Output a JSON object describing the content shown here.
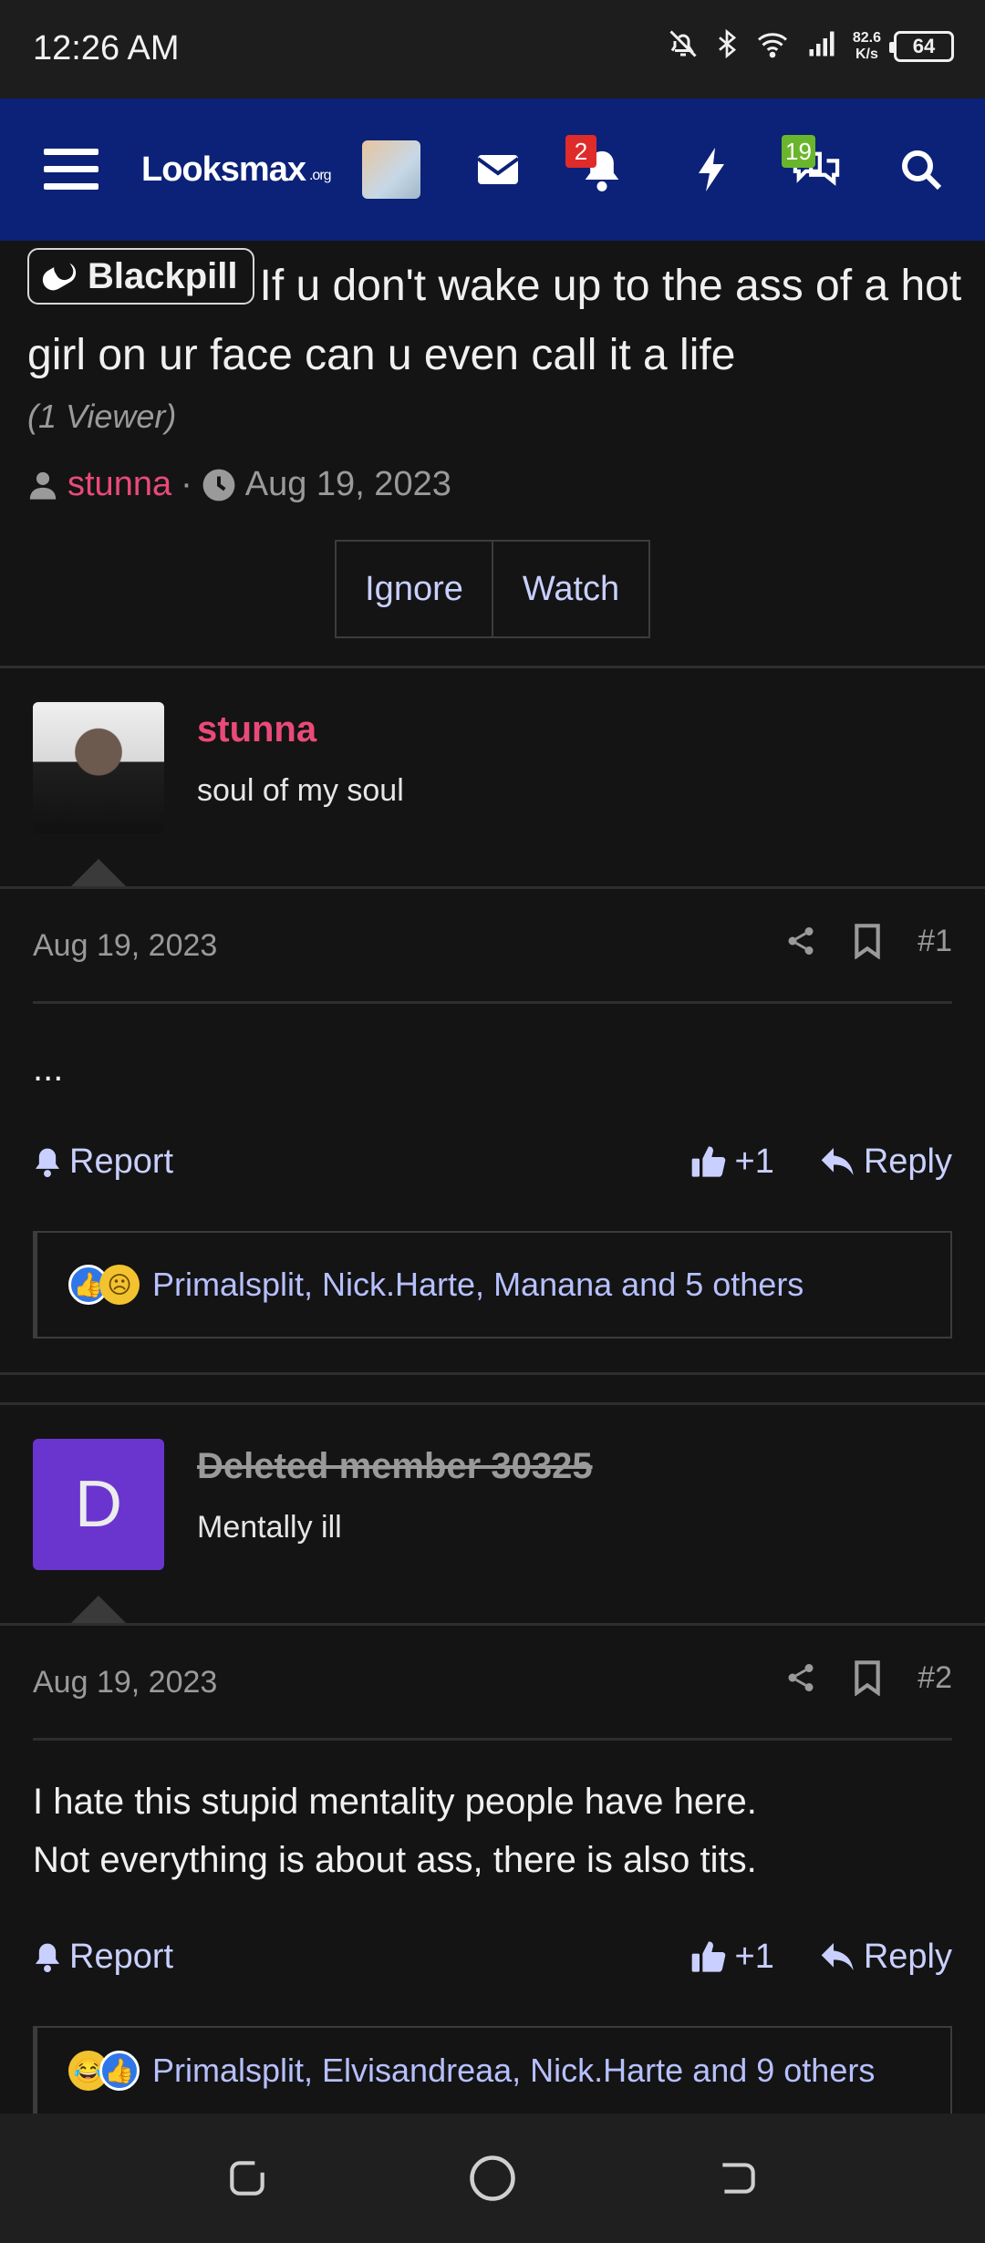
{
  "status_bar": {
    "time": "12:26 AM",
    "speed_value": "82.6",
    "speed_unit": "K/s",
    "battery": "64"
  },
  "nav": {
    "logo_main": "Looksmax",
    "logo_suffix": ".org",
    "alerts_badge": "2",
    "conversations_badge": "19"
  },
  "thread": {
    "prefix": "Blackpill",
    "title": "If u don't wake up to the ass of a hot girl on ur face can u even call it a life",
    "viewers": "(1 Viewer)",
    "author": "stunna",
    "separator": "·",
    "date": "Aug 19, 2023",
    "ignore_label": "Ignore",
    "watch_label": "Watch"
  },
  "posts": [
    {
      "username": "stunna",
      "user_title": "soul of my soul",
      "date": "Aug 19, 2023",
      "number": "#1",
      "body": "...",
      "report_label": "Report",
      "like_label": "+1",
      "reply_label": "Reply",
      "reactions": "Primalsplit, Nick.Harte, Manana and 5 others"
    },
    {
      "username": "Deleted member 30325",
      "avatar_letter": "D",
      "user_title": "Mentally ill",
      "date": "Aug 19, 2023",
      "number": "#2",
      "body_line1": "I hate this stupid mentality people have here.",
      "body_line2": "Not everything is about ass, there is also tits.",
      "report_label": "Report",
      "like_label": "+1",
      "reply_label": "Reply",
      "reactions": "Primalsplit, Elvisandreaa, Nick.Harte and 9 others"
    }
  ],
  "colors": {
    "navbar": "#0b2278",
    "accent_link": "#c9d0ff",
    "username": "#ea4a79",
    "background": "#141414"
  },
  "icons": [
    "bell-off-icon",
    "bluetooth-icon",
    "wifi-icon",
    "signal-icon",
    "hamburger-icon",
    "mail-icon",
    "bell-icon",
    "bolt-icon",
    "chat-icon",
    "search-icon",
    "user-icon",
    "clock-icon",
    "share-icon",
    "bookmark-icon",
    "thumbs-up-icon",
    "reply-icon",
    "recents-icon",
    "home-icon",
    "back-icon"
  ]
}
